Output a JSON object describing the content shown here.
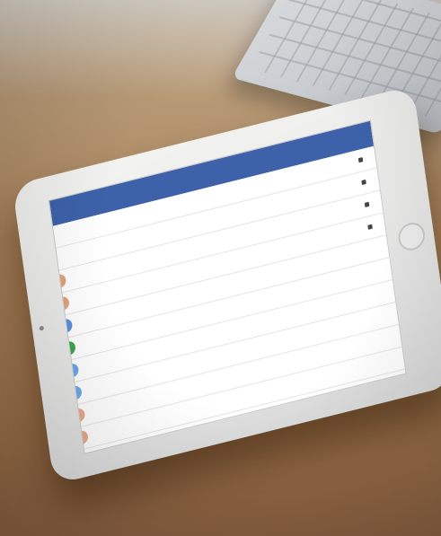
{
  "image": {
    "description_colors": {
      "table": "#a9825a",
      "ipad_frame": "#eeeeee",
      "screen": "#ffffff",
      "header": "#2d55a3",
      "keyboard": "#d4d8dc"
    }
  },
  "app": {
    "header_title": "",
    "rows": [
      {
        "title": "",
        "status": "",
        "icon": "none",
        "color": "#ffffff"
      },
      {
        "title": "",
        "status": "",
        "icon": "none",
        "color": "#ffffff"
      },
      {
        "title": "",
        "status": "",
        "icon": "orange-circle",
        "color": "#e0a27a"
      },
      {
        "title": "",
        "status": "",
        "icon": "orange-circle",
        "color": "#e0a27a"
      },
      {
        "title": "",
        "status": "",
        "icon": "check-circle",
        "color": "#5a8fdc"
      },
      {
        "title": "",
        "status": "",
        "icon": "green-circle",
        "color": "#3ea34a"
      },
      {
        "title": "",
        "status": "",
        "icon": "person-circle",
        "color": "#6aa7e8"
      },
      {
        "title": "",
        "status": "",
        "icon": "person-circle",
        "color": "#6aa7e8"
      },
      {
        "title": "",
        "status": "",
        "icon": "peach-circle",
        "color": "#e8a98a"
      },
      {
        "title": "",
        "status": "",
        "icon": "peach-circle",
        "color": "#e8a98a"
      }
    ]
  }
}
